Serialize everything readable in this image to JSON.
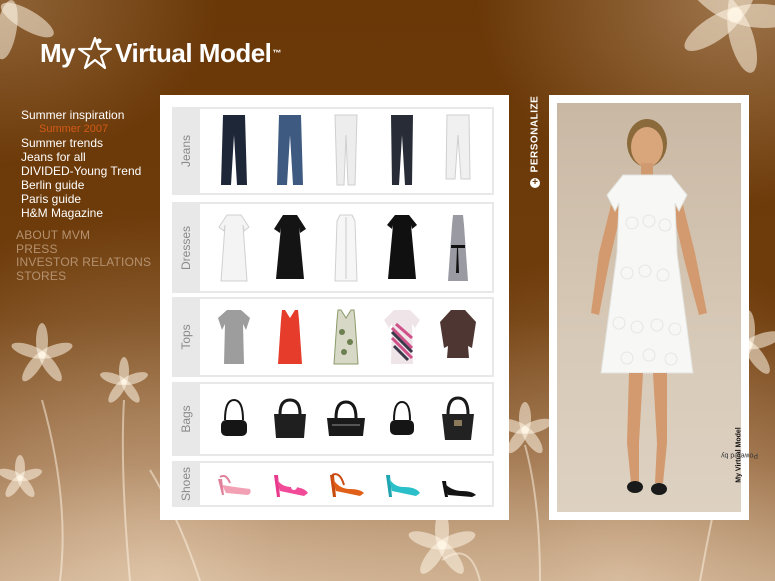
{
  "brand": {
    "logo_my": "My",
    "logo_rest": "Virtual Model",
    "logo_tm": "™"
  },
  "nav": {
    "primary": [
      {
        "label": "Summer inspiration"
      },
      {
        "label": "Summer 2007",
        "sub": true
      },
      {
        "label": "Summer trends"
      },
      {
        "label": "Jeans for all"
      },
      {
        "label": "DIVIDED-Young Trend"
      },
      {
        "label": "Berlin guide"
      },
      {
        "label": "Paris guide"
      },
      {
        "label": "H&M Magazine"
      }
    ],
    "secondary": [
      {
        "label": "ABOUT MVM"
      },
      {
        "label": "PRESS"
      },
      {
        "label": "INVESTOR RELATIONS"
      },
      {
        "label": "STORES"
      }
    ]
  },
  "catalog": {
    "rows": [
      {
        "label": "Jeans",
        "items": [
          "dark-jeans",
          "blue-jeans",
          "white-jeans",
          "black-jeans",
          "white-capri"
        ]
      },
      {
        "label": "Dresses",
        "items": [
          "white-lace-dress",
          "black-tunic-dress",
          "white-shirt-dress",
          "black-babydoll-dress",
          "grey-belted-dress"
        ]
      },
      {
        "label": "Tops",
        "items": [
          "grey-top",
          "red-tank",
          "floral-tank",
          "striped-tee",
          "brown-blouse"
        ]
      },
      {
        "label": "Bags",
        "items": [
          "small-black-bag",
          "large-black-bag",
          "black-duffel-bag",
          "small-black-handbag",
          "black-hobo-bag"
        ]
      },
      {
        "label": "Shoes",
        "items": [
          "pink-sling-heel",
          "pink-pump",
          "orange-sling-heel",
          "turquoise-pump",
          "black-white-pump"
        ]
      }
    ]
  },
  "personalize": {
    "label": "PERSONALIZE",
    "icon": "plus-icon"
  },
  "model": {
    "powered_by": "Powered by",
    "powered_brand": "My Virtual Model"
  },
  "colors": {
    "background": "#6e3b09",
    "accent": "#d25a18",
    "muted_nav": "#b49270"
  }
}
